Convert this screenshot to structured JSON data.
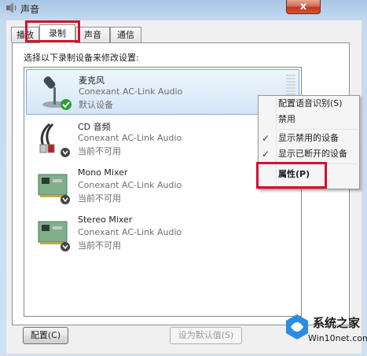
{
  "window": {
    "title": "声音",
    "close_glyph": "x"
  },
  "tabs": [
    {
      "label": "播放",
      "active": false
    },
    {
      "label": "录制",
      "active": true
    },
    {
      "label": "声音",
      "active": false
    },
    {
      "label": "通信",
      "active": false
    }
  ],
  "instruction": "选择以下录制设备来修改设置:",
  "devices": [
    {
      "name": "麦克风",
      "description": "Conexant AC-Link Audio",
      "status": "默认设备",
      "icon": "microphone-icon",
      "badge": "default-check-icon"
    },
    {
      "name": "CD 音频",
      "description": "Conexant AC-Link Audio",
      "status": "当前不可用",
      "icon": "cd-audio-cable-icon",
      "badge": "unavailable-arrow-icon"
    },
    {
      "name": "Mono Mixer",
      "description": "Conexant AC-Link Audio",
      "status": "当前不可用",
      "icon": "sound-card-icon",
      "badge": "unavailable-arrow-icon"
    },
    {
      "name": "Stereo Mixer",
      "description": "Conexant AC-Link Audio",
      "status": "当前不可用",
      "icon": "sound-card-icon",
      "badge": "unavailable-arrow-icon"
    }
  ],
  "context_menu": {
    "items": [
      {
        "label": "配置语音识别(S)",
        "checked": false
      },
      {
        "label": "禁用",
        "checked": false
      },
      {
        "label": "显示禁用的设备",
        "checked": true
      },
      {
        "label": "显示已断开的设备",
        "checked": true
      },
      {
        "label": "属性(P)",
        "checked": false,
        "bold": true
      }
    ],
    "check_glyph": "✓"
  },
  "buttons": {
    "configure": "配置(C)",
    "set_default": "设为默认值(S)"
  },
  "watermark": {
    "brand": "系统之家",
    "url": "Win10net.com"
  },
  "colors": {
    "highlight_red": "#d0112b",
    "selection_blue": "#d5e6f8",
    "default_check_green": "#2f9e2f"
  }
}
